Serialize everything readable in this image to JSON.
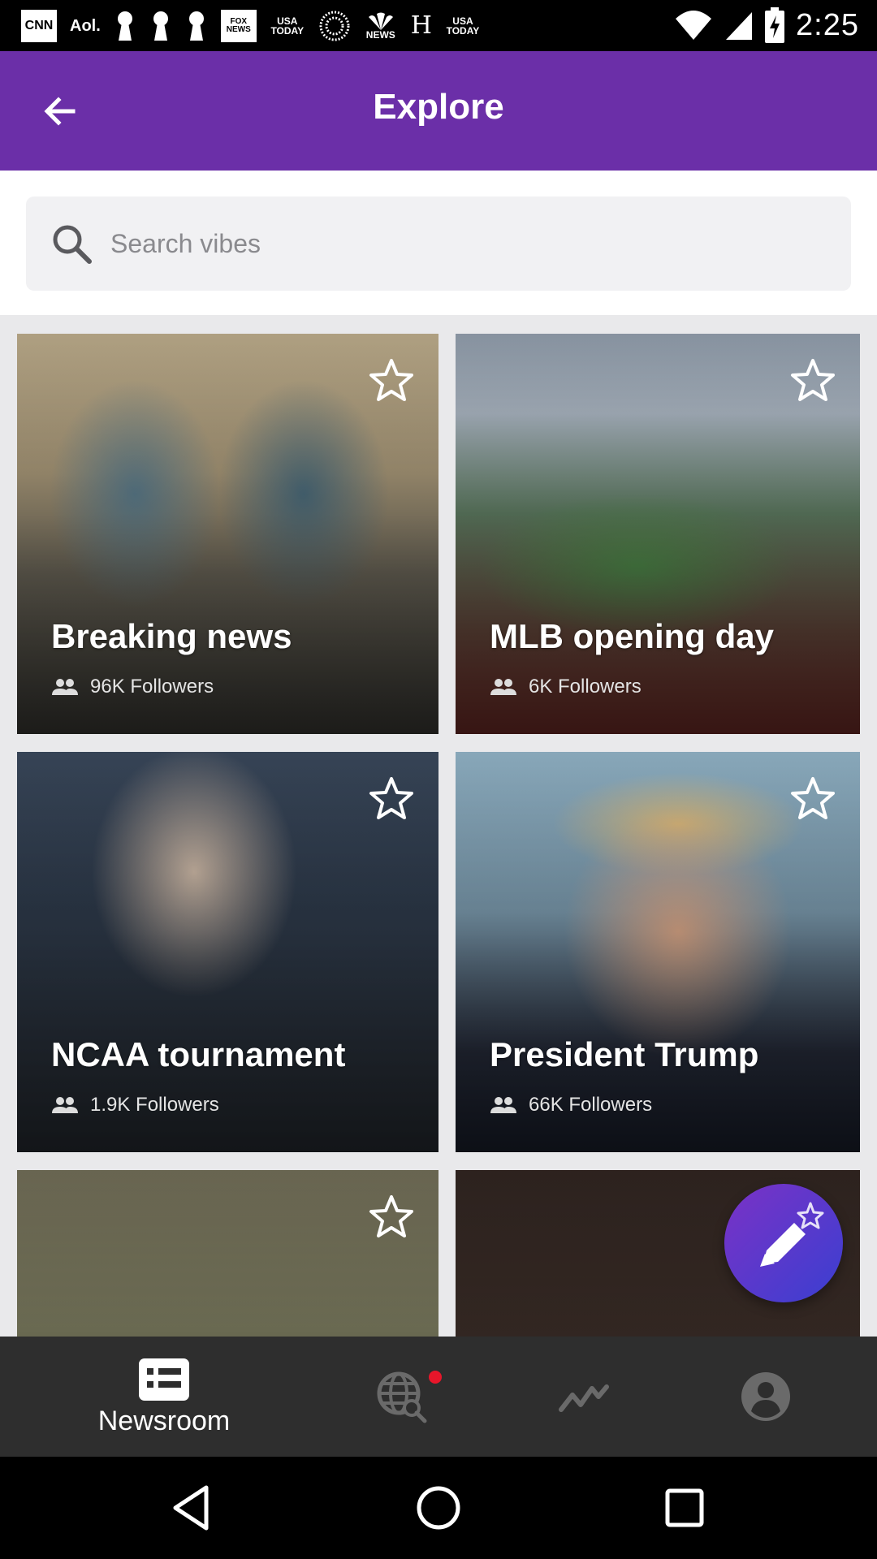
{
  "status_bar": {
    "time": "2:25",
    "notification_icons": [
      {
        "name": "cnn-icon",
        "text": "CNN"
      },
      {
        "name": "aol-icon",
        "text": "Aol."
      },
      {
        "name": "keyhole-icon",
        "text": ""
      },
      {
        "name": "keyhole-icon",
        "text": ""
      },
      {
        "name": "keyhole-icon",
        "text": ""
      },
      {
        "name": "fox-news-icon",
        "text": "FOX NEWS"
      },
      {
        "name": "usa-today-icon",
        "text": "USA TODAY"
      },
      {
        "name": "globe-dots-icon",
        "text": ""
      },
      {
        "name": "nbc-news-icon",
        "text": "NEWS"
      },
      {
        "name": "huffpost-icon",
        "text": "H"
      },
      {
        "name": "usa-today-icon",
        "text": "USA TODAY"
      }
    ],
    "right_icons": [
      "wifi-icon",
      "signal-icon",
      "battery-charging-icon"
    ]
  },
  "app_bar": {
    "title": "Explore",
    "color": "#6b2fa8"
  },
  "search": {
    "placeholder": "Search vibes",
    "value": ""
  },
  "cards": [
    {
      "title": "Breaking news",
      "followers": "96K Followers"
    },
    {
      "title": "MLB opening day",
      "followers": "6K Followers"
    },
    {
      "title": "NCAA tournament",
      "followers": "1.9K Followers"
    },
    {
      "title": "President Trump",
      "followers": "66K Followers"
    },
    {
      "title": "",
      "followers": ""
    },
    {
      "title": "",
      "followers": ""
    }
  ],
  "bottom_nav": {
    "items": [
      {
        "name": "newsroom",
        "label": "Newsroom",
        "icon": "newsroom-icon",
        "active": true
      },
      {
        "name": "explore",
        "label": "",
        "icon": "globe-search-icon",
        "active": false,
        "badge": true
      },
      {
        "name": "trending",
        "label": "",
        "icon": "trending-icon",
        "active": false
      },
      {
        "name": "profile",
        "label": "",
        "icon": "profile-icon",
        "active": false
      }
    ],
    "badge_color": "#e8162a"
  },
  "fab": {
    "icon": "compose-star-icon"
  },
  "system_nav": [
    "back-triangle-icon",
    "home-circle-icon",
    "recents-square-icon"
  ]
}
